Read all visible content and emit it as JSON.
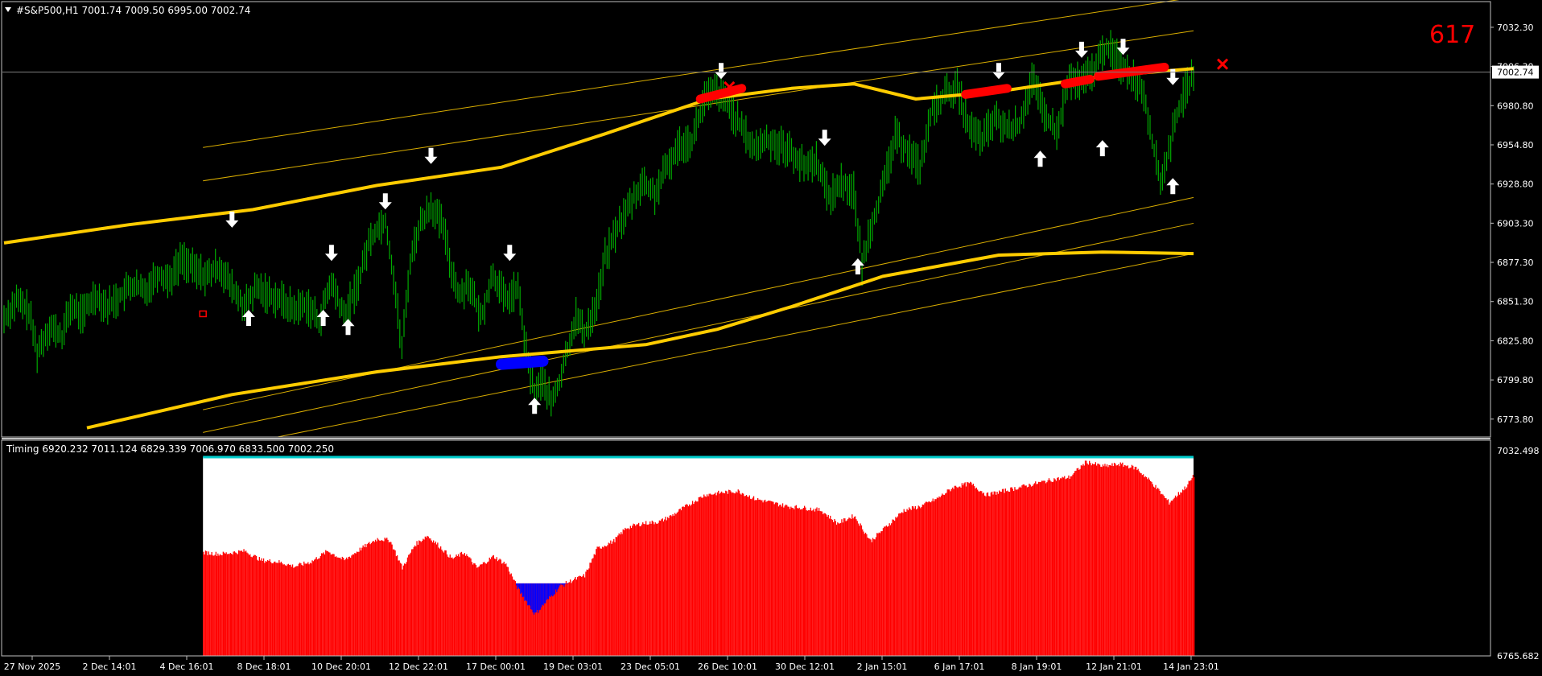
{
  "window": {
    "main_header": "#S&P500,H1  7001.74 7009.50 6995.00 7002.74",
    "counter_label": "617",
    "indicator_header": "Timing 6920.232 7011.124 6829.339 7006.970 6833.500 7002.250"
  },
  "colors": {
    "background": "#000000",
    "frame": "#c0c0c0",
    "candles": "#00aa00",
    "band": "#ffcc00",
    "buy_arrow": "#ffffff",
    "sell_arrow": "#ffffff",
    "red_marker": "#ff0000",
    "blue_marker": "#0000ff",
    "histogram_positive": "#ff0000",
    "histogram_negative": "#0000ff",
    "histogram_fill_top": "#ffffff",
    "histogram_baseline": "#00cccc",
    "counter_text": "#ff0000",
    "axis_text": "#ffffff"
  },
  "icons": {
    "up_arrow": "up-arrow-icon",
    "down_arrow": "down-arrow-icon",
    "cross_marker": "x-marker-icon",
    "small_marker": "square-marker-icon"
  },
  "chart_data": [
    {
      "type": "line",
      "title": "#S&P500,H1  7001.74 7009.50 6995.00 7002.74",
      "xlabel": "",
      "ylabel": "",
      "ylim": [
        6762.0,
        7045.0
      ],
      "ytick_labels": [
        "7032.30",
        "7006.30",
        "6980.80",
        "6954.80",
        "6928.80",
        "6903.30",
        "6877.30",
        "6851.30",
        "6825.80",
        "6799.80",
        "6773.80"
      ],
      "current_price_label": "7002.74",
      "current_price": 7002.74,
      "x_labels": [
        "27 Nov 2025",
        "2 Dec 14:01",
        "4 Dec 16:01",
        "8 Dec 18:01",
        "10 Dec 20:01",
        "12 Dec 22:01",
        "17 Dec 00:01",
        "19 Dec 03:01",
        "23 Dec 05:01",
        "26 Dec 10:01",
        "30 Dec 12:01",
        "2 Jan 15:01",
        "6 Jan 17:01",
        "8 Jan 19:01",
        "12 Jan 21:01",
        "14 Jan 23:01"
      ],
      "x_range": [
        0,
        240
      ],
      "price_points": [
        [
          0,
          6840
        ],
        [
          3,
          6852
        ],
        [
          6,
          6845
        ],
        [
          8,
          6818
        ],
        [
          11,
          6835
        ],
        [
          14,
          6828
        ],
        [
          16,
          6848
        ],
        [
          19,
          6843
        ],
        [
          22,
          6856
        ],
        [
          25,
          6848
        ],
        [
          28,
          6855
        ],
        [
          31,
          6862
        ],
        [
          34,
          6858
        ],
        [
          37,
          6870
        ],
        [
          40,
          6866
        ],
        [
          43,
          6880
        ],
        [
          46,
          6872
        ],
        [
          49,
          6868
        ],
        [
          52,
          6875
        ],
        [
          55,
          6860
        ],
        [
          58,
          6848
        ],
        [
          61,
          6860
        ],
        [
          64,
          6856
        ],
        [
          67,
          6852
        ],
        [
          70,
          6846
        ],
        [
          73,
          6850
        ],
        [
          76,
          6838
        ],
        [
          79,
          6864
        ],
        [
          82,
          6842
        ],
        [
          85,
          6860
        ],
        [
          88,
          6890
        ],
        [
          90,
          6900
        ],
        [
          92,
          6905
        ],
        [
          94,
          6868
        ],
        [
          96,
          6820
        ],
        [
          98,
          6878
        ],
        [
          100,
          6900
        ],
        [
          103,
          6915
        ],
        [
          106,
          6900
        ],
        [
          108,
          6872
        ],
        [
          110,
          6855
        ],
        [
          112,
          6865
        ],
        [
          115,
          6840
        ],
        [
          118,
          6870
        ],
        [
          121,
          6852
        ],
        [
          124,
          6860
        ],
        [
          126,
          6818
        ],
        [
          128,
          6790
        ],
        [
          130,
          6800
        ],
        [
          132,
          6784
        ],
        [
          134,
          6798
        ],
        [
          136,
          6820
        ],
        [
          138,
          6842
        ],
        [
          140,
          6830
        ],
        [
          143,
          6850
        ],
        [
          145,
          6880
        ],
        [
          148,
          6900
        ],
        [
          151,
          6915
        ],
        [
          154,
          6930
        ],
        [
          157,
          6922
        ],
        [
          160,
          6940
        ],
        [
          163,
          6955
        ],
        [
          166,
          6958
        ],
        [
          169,
          6985
        ],
        [
          172,
          6990
        ],
        [
          175,
          6980
        ],
        [
          178,
          6965
        ],
        [
          181,
          6952
        ],
        [
          184,
          6958
        ],
        [
          187,
          6955
        ],
        [
          190,
          6950
        ],
        [
          193,
          6940
        ],
        [
          196,
          6945
        ],
        [
          199,
          6920
        ],
        [
          202,
          6930
        ],
        [
          205,
          6925
        ],
        [
          207,
          6875
        ],
        [
          209,
          6900
        ],
        [
          212,
          6925
        ],
        [
          215,
          6960
        ],
        [
          218,
          6952
        ],
        [
          221,
          6940
        ],
        [
          224,
          6978
        ],
        [
          227,
          6988
        ],
        [
          230,
          6992
        ],
        [
          233,
          6965
        ],
        [
          236,
          6958
        ],
        [
          239,
          6972
        ],
        [
          242,
          6965
        ],
        [
          245,
          6968
        ],
        [
          248,
          6998
        ],
        [
          251,
          6975
        ],
        [
          254,
          6962
        ],
        [
          257,
          6998
        ],
        [
          260,
          6995
        ],
        [
          263,
          7005
        ],
        [
          266,
          7020
        ],
        [
          269,
          7010
        ],
        [
          272,
          7000
        ],
        [
          275,
          6990
        ],
        [
          277,
          6958
        ],
        [
          279,
          6930
        ],
        [
          281,
          6950
        ],
        [
          283,
          6975
        ],
        [
          285,
          6990
        ],
        [
          287,
          7002
        ]
      ],
      "timing_line": [
        [
          0,
          6890
        ],
        [
          30,
          6902
        ],
        [
          60,
          6912
        ],
        [
          90,
          6928
        ],
        [
          120,
          6940
        ],
        [
          145,
          6962
        ],
        [
          170,
          6985
        ],
        [
          190,
          6992
        ],
        [
          205,
          6995
        ],
        [
          220,
          6985
        ],
        [
          240,
          6990
        ],
        [
          265,
          7000
        ],
        [
          287,
          7005
        ]
      ],
      "lower_line": [
        [
          20,
          6768
        ],
        [
          55,
          6790
        ],
        [
          90,
          6805
        ],
        [
          120,
          6815
        ],
        [
          155,
          6823
        ],
        [
          172,
          6833
        ],
        [
          190,
          6848
        ],
        [
          212,
          6868
        ],
        [
          240,
          6882
        ],
        [
          265,
          6884
        ],
        [
          287,
          6883
        ]
      ],
      "channel_lines": [
        [
          [
            48,
            6953
          ],
          [
            287,
            7052
          ]
        ],
        [
          [
            48,
            6931
          ],
          [
            287,
            7030
          ]
        ],
        [
          [
            48,
            6780
          ],
          [
            287,
            6920
          ]
        ],
        [
          [
            48,
            6765
          ],
          [
            287,
            6903
          ]
        ],
        [
          [
            66,
            6762
          ],
          [
            287,
            6883
          ]
        ]
      ],
      "up_arrows": [
        [
          59,
          6848
        ],
        [
          77,
          6848
        ],
        [
          83,
          6842
        ],
        [
          128,
          6790
        ],
        [
          206,
          6882
        ],
        [
          250,
          6953
        ],
        [
          265,
          6960
        ],
        [
          282,
          6935
        ]
      ],
      "down_arrows": [
        [
          55,
          6898
        ],
        [
          79,
          6876
        ],
        [
          92,
          6910
        ],
        [
          103,
          6940
        ],
        [
          122,
          6876
        ],
        [
          173,
          6996
        ],
        [
          198,
          6952
        ],
        [
          240,
          6996
        ],
        [
          260,
          7010
        ],
        [
          270,
          7012
        ],
        [
          282,
          6992
        ]
      ],
      "red_segments": [
        [
          [
            168,
            6985
          ],
          [
            178,
            6992
          ]
        ],
        [
          [
            232,
            6988
          ],
          [
            242,
            6992
          ]
        ],
        [
          [
            256,
            6995
          ],
          [
            262,
            6998
          ]
        ],
        [
          [
            264,
            7000
          ],
          [
            280,
            7006
          ]
        ]
      ],
      "red_crosses": [
        [
          175,
          6993
        ],
        [
          294,
          7008
        ]
      ],
      "blue_segment": [
        [
          120,
          6810
        ],
        [
          130,
          6812
        ]
      ],
      "small_marker": [
        48,
        6843
      ]
    },
    {
      "type": "area",
      "title": "Timing 6920.232 7011.124 6829.339 7006.970 6833.500 7002.250",
      "ylim": [
        6765.682,
        7032.498
      ],
      "ytick_labels": [
        "7032.498",
        "6765.682"
      ],
      "baseline": 6860,
      "points": [
        [
          48,
          6900
        ],
        [
          52,
          6898
        ],
        [
          58,
          6902
        ],
        [
          62,
          6890
        ],
        [
          66,
          6888
        ],
        [
          70,
          6882
        ],
        [
          74,
          6888
        ],
        [
          78,
          6902
        ],
        [
          82,
          6890
        ],
        [
          86,
          6905
        ],
        [
          90,
          6918
        ],
        [
          93,
          6916
        ],
        [
          96,
          6880
        ],
        [
          99,
          6910
        ],
        [
          102,
          6922
        ],
        [
          105,
          6908
        ],
        [
          108,
          6892
        ],
        [
          111,
          6900
        ],
        [
          114,
          6880
        ],
        [
          118,
          6895
        ],
        [
          121,
          6885
        ],
        [
          124,
          6852
        ],
        [
          128,
          6820
        ],
        [
          131,
          6838
        ],
        [
          134,
          6856
        ],
        [
          137,
          6864
        ],
        [
          140,
          6870
        ],
        [
          143,
          6905
        ],
        [
          147,
          6915
        ],
        [
          150,
          6932
        ],
        [
          154,
          6938
        ],
        [
          158,
          6940
        ],
        [
          161,
          6948
        ],
        [
          165,
          6962
        ],
        [
          169,
          6975
        ],
        [
          173,
          6978
        ],
        [
          177,
          6980
        ],
        [
          181,
          6970
        ],
        [
          185,
          6965
        ],
        [
          189,
          6960
        ],
        [
          193,
          6958
        ],
        [
          197,
          6955
        ],
        [
          201,
          6938
        ],
        [
          205,
          6948
        ],
        [
          209,
          6915
        ],
        [
          213,
          6935
        ],
        [
          217,
          6955
        ],
        [
          221,
          6960
        ],
        [
          225,
          6970
        ],
        [
          229,
          6985
        ],
        [
          233,
          6990
        ],
        [
          237,
          6975
        ],
        [
          241,
          6980
        ],
        [
          245,
          6985
        ],
        [
          249,
          6990
        ],
        [
          253,
          6995
        ],
        [
          257,
          6998
        ],
        [
          261,
          7018
        ],
        [
          265,
          7012
        ],
        [
          269,
          7015
        ],
        [
          273,
          7010
        ],
        [
          277,
          6990
        ],
        [
          281,
          6965
        ],
        [
          285,
          6985
        ],
        [
          287,
          7000
        ]
      ]
    }
  ]
}
